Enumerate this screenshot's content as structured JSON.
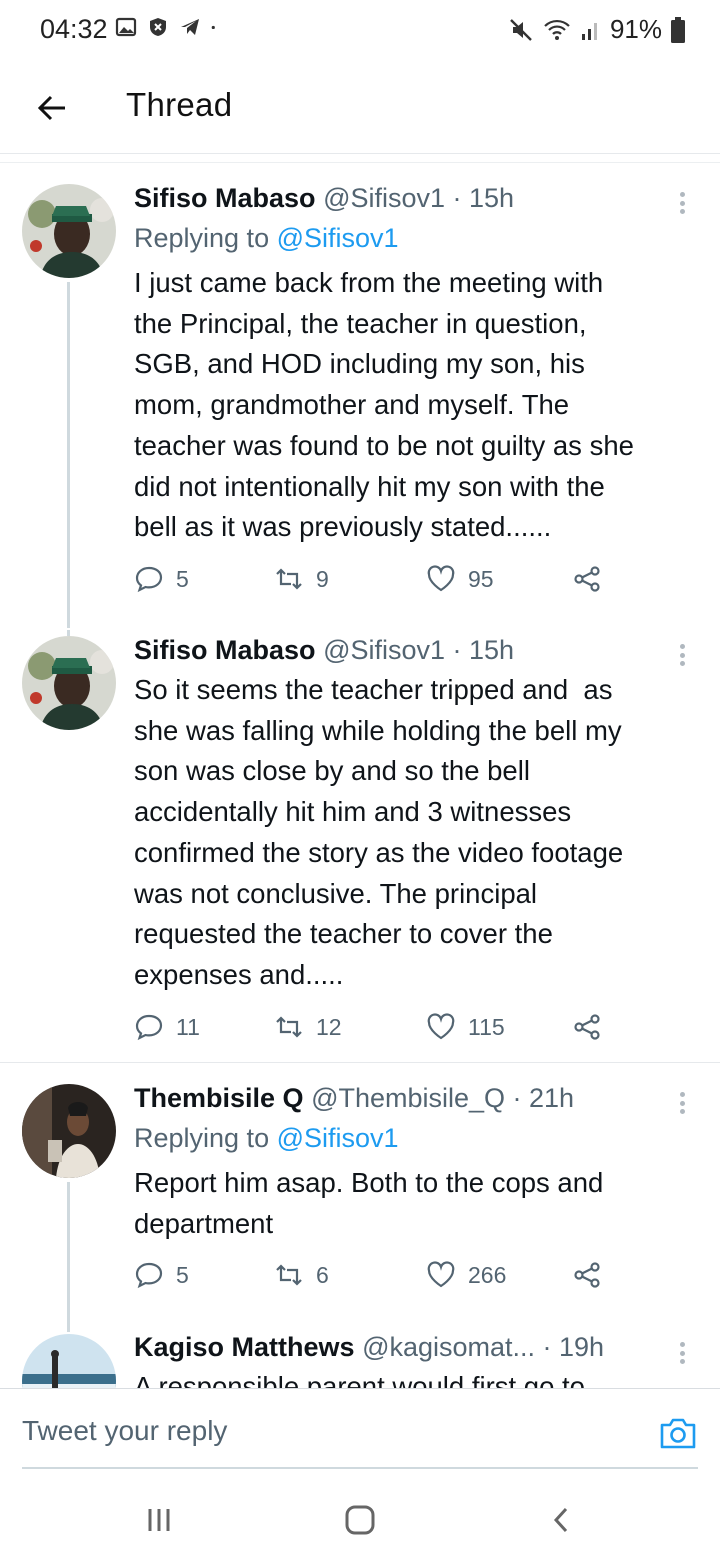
{
  "status_bar": {
    "time": "04:32",
    "battery": "91%",
    "left_icons": [
      "gallery-icon",
      "shield-icon",
      "telegram-icon",
      "dot-icon"
    ],
    "right_icons": [
      "mute-icon",
      "wifi-icon",
      "signal-icon",
      "battery-icon"
    ]
  },
  "header": {
    "title": "Thread",
    "back_icon": "arrow-left-icon"
  },
  "tweets": [
    {
      "name": "Sifiso Mabaso",
      "meta": "@Sifisov1 · 15h",
      "replying_prefix": "Replying to",
      "replying_to": "@Sifisov1",
      "text": "I just came back from the meeting with\nthe Principal, the teacher in question,\nSGB, and HOD including my son, his\nmom, grandmother and myself. The\nteacher was found to be not guilty as she\ndid not intentionally hit my son with the\nbell as it was previously stated......",
      "replies": "5",
      "retweets": "9",
      "likes": "95"
    },
    {
      "name": "Sifiso Mabaso",
      "meta": "@Sifisov1 · 15h",
      "text": "So it seems the teacher tripped and  as\nshe was falling while holding the bell my\nson was close by and so the bell\naccidentally hit him and 3 witnesses\nconfirmed the story as the video footage\nwas not conclusive. The principal\nrequested the teacher to cover the\nexpenses and.....",
      "replies": "11",
      "retweets": "12",
      "likes": "115"
    },
    {
      "name": "Thembisile Q",
      "meta": "@Thembisile_Q · 21h",
      "replying_prefix": "Replying to",
      "replying_to": "@Sifisov1",
      "text": "Report him asap. Both to the cops and\ndepartment",
      "replies": "5",
      "retweets": "6",
      "likes": "266"
    },
    {
      "name": "Kagiso Matthews",
      "meta": "@kagisomat... · 19h",
      "text": "A responsible parent would first go to"
    }
  ],
  "reply_bar": {
    "placeholder": "Tweet your reply",
    "camera_icon": "camera-icon"
  },
  "nav_bar": {
    "icons": [
      "recent-apps-icon",
      "home-icon",
      "back-icon"
    ]
  },
  "colors": {
    "accent": "#1d9bf0",
    "muted": "#536471",
    "text": "#0f1419",
    "thread_line": "#cfd9de"
  }
}
